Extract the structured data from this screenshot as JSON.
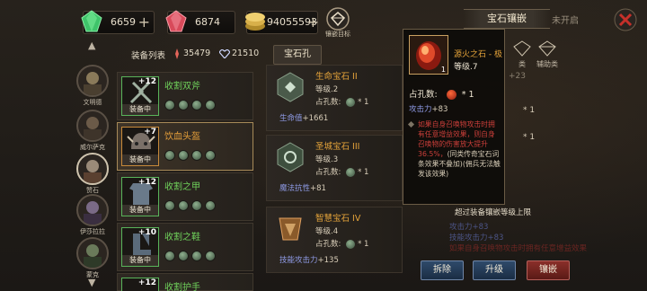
{
  "resources": [
    {
      "name": "green-gem",
      "value": "6659",
      "color": "#3fc36a"
    },
    {
      "name": "red-gem",
      "value": "6874",
      "color": "#e0606a"
    },
    {
      "name": "gold-coins",
      "value": "94055593",
      "color": "#d8b04a"
    }
  ],
  "home_label": "镶嵌目标",
  "title_tabs": {
    "active": "宝石镶嵌",
    "inactive": "未开启"
  },
  "heroes": [
    {
      "name": "文明德"
    },
    {
      "name": "威尔萨克"
    },
    {
      "name": "赞石"
    },
    {
      "name": "伊莎拉拉"
    },
    {
      "name": "蒙克"
    }
  ],
  "headers": {
    "equip_list": "装备列表",
    "stat1": "35479",
    "stat2": "21510",
    "gem_hole_tab": "宝石孔"
  },
  "equipment": [
    {
      "name": "收割双斧",
      "plus": "+12",
      "status": "装备中",
      "color": "g"
    },
    {
      "name": "饮血头盔",
      "plus": "+7",
      "status": "装备中",
      "color": "o"
    },
    {
      "name": "收割之甲",
      "plus": "+12",
      "status": "装备中",
      "color": "g"
    },
    {
      "name": "收割之鞋",
      "plus": "+10",
      "status": "装备中",
      "color": "g"
    },
    {
      "name": "收割护手",
      "plus": "+12",
      "status": "",
      "color": "g"
    }
  ],
  "gem_slots": [
    {
      "name": "生命宝石 II",
      "level": "等级.2",
      "holes_label": "占孔数:",
      "holes": "* 1",
      "stat_label": "生命值",
      "stat_value": "+1661"
    },
    {
      "name": "圣城宝石 III",
      "level": "等级.3",
      "holes_label": "占孔数:",
      "holes": "* 1",
      "stat_label": "魔法抗性",
      "stat_value": "+81"
    },
    {
      "name": "智慧宝石 IV",
      "level": "等级.4",
      "holes_label": "占孔数:",
      "holes": "* 1",
      "stat_label": "技能攻击力",
      "stat_value": "+135"
    }
  ],
  "tooltip": {
    "name": "源火之石 - 极",
    "level": "等级.7",
    "count": "1",
    "holes_label": "占孔数:",
    "holes": "* 1",
    "stat_label": "攻击力",
    "stat_value": "+83",
    "desc_red": "如果自身召唤物攻击时拥有任意增益效果，则自身召唤物的伤害放大提升36.5%，",
    "desc_white": "(同类传奇宝石词条效果不叠加)(佣兵无法触发该效果)"
  },
  "right_panel": {
    "tabs": [
      "类",
      "辅助类"
    ],
    "items": [
      "+23",
      "* 1",
      "* 1"
    ],
    "faded": [
      "攻击力+83",
      "技能攻击力+83",
      "如果自身召唤物攻击时拥有任意增益效果"
    ],
    "limit_text": "超过装备镶嵌等级上限"
  },
  "buttons": {
    "remove": "拆除",
    "upgrade": "升级",
    "inlay": "镶嵌"
  }
}
